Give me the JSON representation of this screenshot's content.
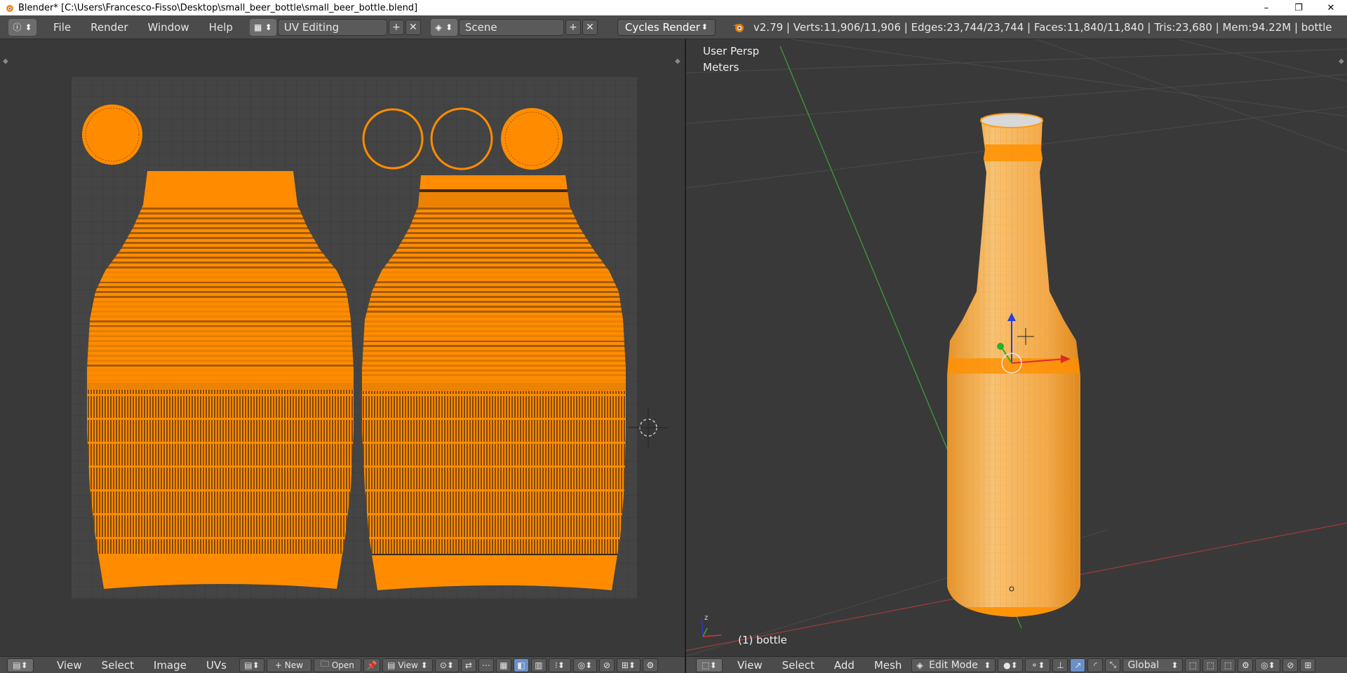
{
  "window": {
    "title": "Blender* [C:\\Users\\Francesco-Fisso\\Desktop\\small_beer_bottle\\small_beer_bottle.blend]",
    "controls": [
      "–",
      "❐",
      "✕"
    ]
  },
  "top_header": {
    "menus": [
      "File",
      "Render",
      "Window",
      "Help"
    ],
    "screen_layout": "UV Editing",
    "scene": "Scene",
    "render_engine": "Cycles Render",
    "stats": "v2.79 | Verts:11,906/11,906 | Edges:23,744/23,744 | Faces:11,840/11,840 | Tris:23,680 | Mem:94.22M | bottle",
    "icons": [
      "info-editor-icon",
      "screen-layout-icon",
      "scene-icon",
      "add-icon",
      "close-icon",
      "blender-logo-icon"
    ]
  },
  "viewport3d": {
    "view_name": "User Persp",
    "units": "Meters",
    "object_label": "(1) bottle"
  },
  "uv_footer": {
    "items": [
      "View",
      "Select",
      "Image",
      "UVs"
    ],
    "new_label": "New",
    "open_label": "Open",
    "view_label": "View"
  },
  "view3d_footer": {
    "items": [
      "View",
      "Select",
      "Add",
      "Mesh"
    ],
    "mode": "Edit Mode",
    "orientation": "Global"
  },
  "colors": {
    "background": "#393939",
    "header": "#4b4b4b",
    "selection_orange": "#ff8c00",
    "uv_grid": "#444444"
  }
}
